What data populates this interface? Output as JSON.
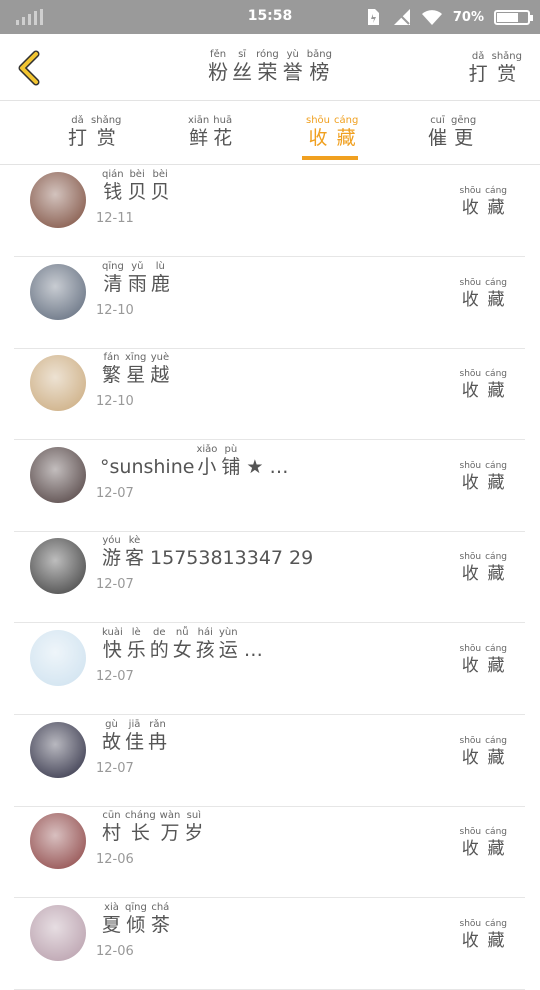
{
  "status_bar": {
    "time": "15:58",
    "battery": "70%",
    "battery_level": 0.7
  },
  "header": {
    "title": [
      {
        "py": "fěn",
        "hz": "粉"
      },
      {
        "py": "sī",
        "hz": "丝"
      },
      {
        "py": "róng",
        "hz": "荣"
      },
      {
        "py": "yù",
        "hz": "誉"
      },
      {
        "py": "bǎng",
        "hz": "榜"
      }
    ],
    "reward": [
      {
        "py": "dǎ",
        "hz": "打"
      },
      {
        "py": "shǎng",
        "hz": "赏"
      }
    ]
  },
  "tabs": [
    {
      "id": "reward",
      "chars": [
        {
          "py": "dǎ",
          "hz": "打"
        },
        {
          "py": "shǎng",
          "hz": "赏"
        }
      ]
    },
    {
      "id": "flowers",
      "chars": [
        {
          "py": "xiān",
          "hz": "鲜"
        },
        {
          "py": "huā",
          "hz": "花"
        }
      ]
    },
    {
      "id": "favorite",
      "chars": [
        {
          "py": "shōu",
          "hz": "收"
        },
        {
          "py": "cáng",
          "hz": "藏"
        }
      ]
    },
    {
      "id": "urge",
      "chars": [
        {
          "py": "cuī",
          "hz": "催"
        },
        {
          "py": "gēng",
          "hz": "更"
        }
      ]
    }
  ],
  "active_tab": "favorite",
  "action_label": [
    {
      "py": "shōu",
      "hz": "收"
    },
    {
      "py": "cáng",
      "hz": "藏"
    }
  ],
  "users": [
    {
      "name": [
        {
          "py": "qián",
          "hz": "钱"
        },
        {
          "py": "bèi",
          "hz": "贝"
        },
        {
          "py": "bèi",
          "hz": "贝"
        }
      ],
      "date": "12-11",
      "avatar_color": "#7a4a3a"
    },
    {
      "name": [
        {
          "py": "qīng",
          "hz": "清"
        },
        {
          "py": "yǔ",
          "hz": "雨"
        },
        {
          "py": "lù",
          "hz": "鹿"
        }
      ],
      "date": "12-10",
      "avatar_color": "#5a6678"
    },
    {
      "name": [
        {
          "py": "fán",
          "hz": "繁"
        },
        {
          "py": "xīng",
          "hz": "星"
        },
        {
          "py": "yuè",
          "hz": "越"
        }
      ],
      "date": "12-10",
      "avatar_color": "#c9a87a"
    },
    {
      "prefix": "°sunshine",
      "name": [
        {
          "py": "xiǎo",
          "hz": "小"
        },
        {
          "py": "pù",
          "hz": "铺"
        }
      ],
      "suffix": "★ …",
      "date": "12-07",
      "avatar_color": "#4a3a3a"
    },
    {
      "prefix": "",
      "name": [
        {
          "py": "yóu",
          "hz": "游"
        },
        {
          "py": "kè",
          "hz": "客"
        }
      ],
      "suffix": "15753813347 29",
      "date": "12-07",
      "avatar_color": "#3a3a3a"
    },
    {
      "name": [
        {
          "py": "kuài",
          "hz": "快"
        },
        {
          "py": "lè",
          "hz": "乐"
        },
        {
          "py": "de",
          "hz": "的"
        },
        {
          "py": "nǚ",
          "hz": "女"
        },
        {
          "py": "hái",
          "hz": "孩"
        },
        {
          "py": "yùn",
          "hz": "运"
        }
      ],
      "suffix": "…",
      "date": "12-07",
      "avatar_color": "#cde1ef"
    },
    {
      "name": [
        {
          "py": "gù",
          "hz": "故"
        },
        {
          "py": "jiā",
          "hz": "佳"
        },
        {
          "py": "rǎn",
          "hz": "冉"
        }
      ],
      "date": "12-07",
      "avatar_color": "#2a2a40"
    },
    {
      "name": [
        {
          "py": "cūn",
          "hz": "村"
        },
        {
          "py": "cháng",
          "hz": "长"
        },
        {
          "py": "wàn",
          "hz": "万"
        },
        {
          "py": "suì",
          "hz": "岁"
        }
      ],
      "date": "12-06",
      "avatar_color": "#8a4040"
    },
    {
      "name": [
        {
          "py": "xià",
          "hz": "夏"
        },
        {
          "py": "qīng",
          "hz": "倾"
        },
        {
          "py": "chá",
          "hz": "茶"
        }
      ],
      "date": "12-06",
      "avatar_color": "#b59aa8"
    }
  ]
}
